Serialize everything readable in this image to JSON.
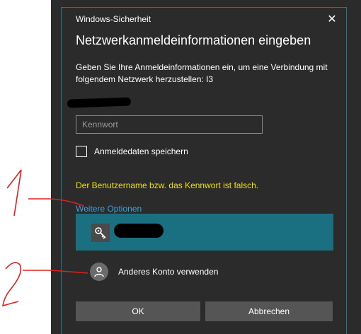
{
  "window": {
    "app_title": "Windows-Sicherheit",
    "close_glyph": "✕"
  },
  "dialog": {
    "heading": "Netzwerkanmeldeinformationen eingeben",
    "description": "Geben Sie Ihre Anmeldeinformationen ein, um eine Verbindung mit folgendem Netzwerk herzustellen: I3",
    "password": {
      "placeholder": "Kennwort",
      "value": ""
    },
    "remember": {
      "label": "Anmeldedaten speichern",
      "checked": false
    },
    "error": "Der Benutzername bzw. das Kennwort ist falsch.",
    "more_options": "Weitere Optionen",
    "credential_tile": {
      "icon": "key-icon"
    },
    "other_account": {
      "label": "Anderes Konto verwenden",
      "icon": "person-icon"
    },
    "buttons": {
      "ok": "OK",
      "cancel": "Abbrechen"
    }
  },
  "annotations": {
    "numbers": [
      "1",
      "2"
    ],
    "color": "#e02020"
  },
  "colors": {
    "background": "#2b2b2b",
    "accent_tile": "#1a6f80",
    "link": "#3aa3e3",
    "error": "#f0e000",
    "button": "#555555"
  }
}
